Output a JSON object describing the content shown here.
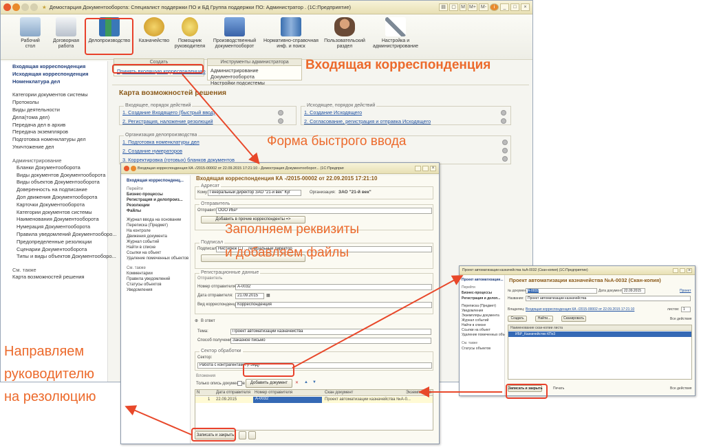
{
  "main_window": {
    "title": "Демостарция Документооборота: Специалист поддержки ПО и БД Группа поддержки ПО: Администратор . (1С:Предприятие)",
    "toolbar_right": [
      "M",
      "M+",
      "M-"
    ],
    "sections": [
      {
        "label": "Рабочий стол",
        "line1": "Рабочий",
        "line2": "стол",
        "icon": "desk-icon",
        "color": "#9fb8d3"
      },
      {
        "label": "Договорная работа",
        "line1": "Договорная",
        "line2": "работа",
        "icon": "contract-icon",
        "color": "#c5ccd6"
      },
      {
        "label": "Делопроизводство",
        "line1": "Делопроизводство",
        "line2": "",
        "icon": "binders-icon",
        "color": "#3a78b8"
      },
      {
        "label": "Казначейство",
        "line1": "Казначейство",
        "line2": "",
        "icon": "coins-icon",
        "color": "#e0b23a"
      },
      {
        "label": "Помощник руководителя",
        "line1": "Помощник",
        "line2": "руководителя",
        "icon": "helper-icon",
        "color": "#e7c642"
      },
      {
        "label": "Производственный документооборот",
        "line1": "Производственный",
        "line2": "документооборот",
        "icon": "person-doc-icon",
        "color": "#4f7cc4"
      },
      {
        "label": "Нормативно-справочная инф. и поиск",
        "line1": "Нормативно-справочная",
        "line2": "инф. и поиск",
        "icon": "books-icon",
        "color": "#5a88c6"
      },
      {
        "label": "Пользовательский раздел",
        "line1": "Пользовательский",
        "line2": "раздел",
        "icon": "user-icon",
        "color": "#8a6a4e"
      },
      {
        "label": "Настройка и администрирование",
        "line1": "Настройка и",
        "line2": "администрирование",
        "icon": "tools-icon",
        "color": "#8f9ba8"
      }
    ],
    "left_nav_top": [
      "Входящая корреспонденция",
      "Исходящая корреспонденция",
      "Номенклатура дел"
    ],
    "left_nav_list": [
      "Категории документов системы",
      "Протоколы",
      "Виды деятельности",
      "Дела(тома дел)",
      "Передача дел в архив",
      "Передача экземпляров",
      "Подготовка номенклатуры дел",
      "Уничтожение дел"
    ],
    "admin_head": "Администрирование",
    "admin_list": [
      "Бланки Документооборота",
      "Виды документов Документооборота",
      "Виды объектов Документооборота",
      "Доверенность на подписание",
      "Доп движения Документооборота",
      "Карточки Документооборота",
      "Категории документов системы",
      "Наименования Документооборота",
      "Нумерация Документооборота",
      "Правила уведомлений Документооборо...",
      "Предопределенные резолюции",
      "Сценарии Документооборота",
      "Типы и виды объектов Документооборо..."
    ],
    "see_also_head": "См. также",
    "see_also": [
      "Карта возможностей решения"
    ],
    "create_head": "Создать",
    "create_link": "Принять входящую корреспонденцию",
    "admin_tools_head": "Инструменты администратора",
    "admin_tools": [
      "Администрирование Документооборота",
      "Настройки подсистемы"
    ],
    "card_title": "Карта возможностей решения",
    "incoming_head": "Входящее, порядок действий",
    "incoming": [
      "1. Создание Входящего (быстрый ввод)",
      "2. Регистрация, наложение резолюций"
    ],
    "outgoing_head": "Исходящее, порядок действий",
    "outgoing": [
      "1. Создание Исходящего",
      "2. Согласование, регистрация и отправка Исходящего"
    ],
    "org_head": "Организация делопроизводства",
    "org": [
      "1. Подготовка номенклатуры дел",
      "2. Создание нумераторов",
      "3. Корректировка (готовых) бланков документов"
    ]
  },
  "form_window": {
    "title": "Входящая корреспонденция  КА  -/2015-00002 от 22.09.2015 17:21:10 - Демострация Документооборот...  (1С:Предприятие)",
    "header": "Входящая корреспонденция  КА  -/2015-00002 от 22.09.2015 17:21:10",
    "left_title": "Входящая корреспонденц...",
    "goto": "Перейти",
    "left_bold": [
      "Бизнес-процессы",
      "Регистрация и делопроиз...",
      "Резолюции",
      "Файлы"
    ],
    "left_list": [
      "Журнал ввода на основании",
      "Переписка (Предмет)",
      "На контроле",
      "Движения документа",
      "Журнал событий",
      "Найти в списке",
      "Ссылки на объект",
      "Удаление помеченных объектов"
    ],
    "see_also_head": "См. также",
    "see_also": [
      "Комментарии",
      "Правила уведомлений",
      "Статусы объектов",
      "Уведомления"
    ],
    "addressee_legend": "Адресат",
    "to_label": "Кому:",
    "to_value": "Генеральный директор ЗАО \"21-й век\" Куг",
    "org_label": "Организация:",
    "org_value": "ЗАО \"21-й век\"",
    "sender_legend": "Отправитель",
    "sender_label": "Отправитель:",
    "sender_value": "ООО ИБР",
    "add_corr_button": "Добавить в прочие корреспонденты =>",
    "signed_legend": "Подписал",
    "signed_label": "Подписал:",
    "signed_value": "Нистирюк С.Г. , генеральный директор",
    "reg_legend": "Регистрационные данные",
    "sender_sub": "Отправитель",
    "num_label": "Номер отправителя:",
    "num_value": "А-0032",
    "date_label": "Дата отправителя:",
    "date_value": "21.09.2015",
    "kind_label": "Вид корреспонденции:",
    "kind_value": "Корреспонденция",
    "reply_label": "В ответ",
    "topic_label": "Тема:",
    "topic_value": "Проект автоматизации казначейства",
    "method_label": "Способ получения:",
    "method_value": "Заказное письмо",
    "sector_legend": "Сектор обработки",
    "sector_label": "Сектор:",
    "sector_value": "Работа с контрагентами (ГЗиД)",
    "attach_label": "Вложения",
    "only_scan": "Только опись документов",
    "add_doc_button": "Добавить документ",
    "table_headers": [
      "N",
      "Дата отправителя",
      "Номер отправителя",
      "Скан документ",
      "Экземпляров"
    ],
    "table_rows": [
      [
        "1",
        "22.09.2015",
        "А-0032",
        "Проект автоматизации казначейства №А-0..."
      ]
    ],
    "save_close": "Записать и закрыть"
  },
  "scan_window": {
    "title": "Проект автоматизации казначейства №А-0032 (Скан-копия) (1С:Предприятие)",
    "left_title": "Проект автоматизации...",
    "goto": "Перейти",
    "left_bold": [
      "Бизнес-процессы",
      "Регистрация и делоп..."
    ],
    "left_list": [
      "Переписка (Предмет)",
      "Уведомления",
      "Экземпляры документа",
      "Журнал событий",
      "Найти в списке",
      "Ссылки на объект",
      "Удаление помеченных объектов"
    ],
    "see_also_head": "См. также",
    "see_also": [
      "Статусы объектов"
    ],
    "header": "Проект автоматизации казначейства №А-0032 (Скан-копия)",
    "doc_num_label": "№ документа:",
    "doc_num_value": "А-0032",
    "doc_date_label": "Дата документа:",
    "doc_date_value": "22.09.2015",
    "project": "Проект",
    "name_label": "Название:",
    "name_value": "Проект автоматизации казначейства",
    "owner_label": "Владелец:",
    "owner_value": "Входящая корреспонденция КА -/2015-00002 от 22.09.2015 17:21:10",
    "sheets_label": "листов:",
    "sheets_value": "1",
    "create": "Создать",
    "find": "Найти...",
    "scan": "Сканировать",
    "all_actions": "Все действия",
    "list_header": "Наименование скан-копии листа",
    "list_row": "ИБР_Казначейство КПо3",
    "save_close": "Записать и закрыть",
    "print": "Печать"
  },
  "annotations": {
    "incoming": "Входящая корреспонденция",
    "quick_form": "Форма быстрого ввода",
    "fill_line1": "Заполняем реквизиты",
    "fill_line2": "и добавляем файлы",
    "send_line1": "Направляем",
    "send_line2": "руководителю",
    "send_line3": "на резолюцию",
    "color": "#ec6a2c"
  }
}
